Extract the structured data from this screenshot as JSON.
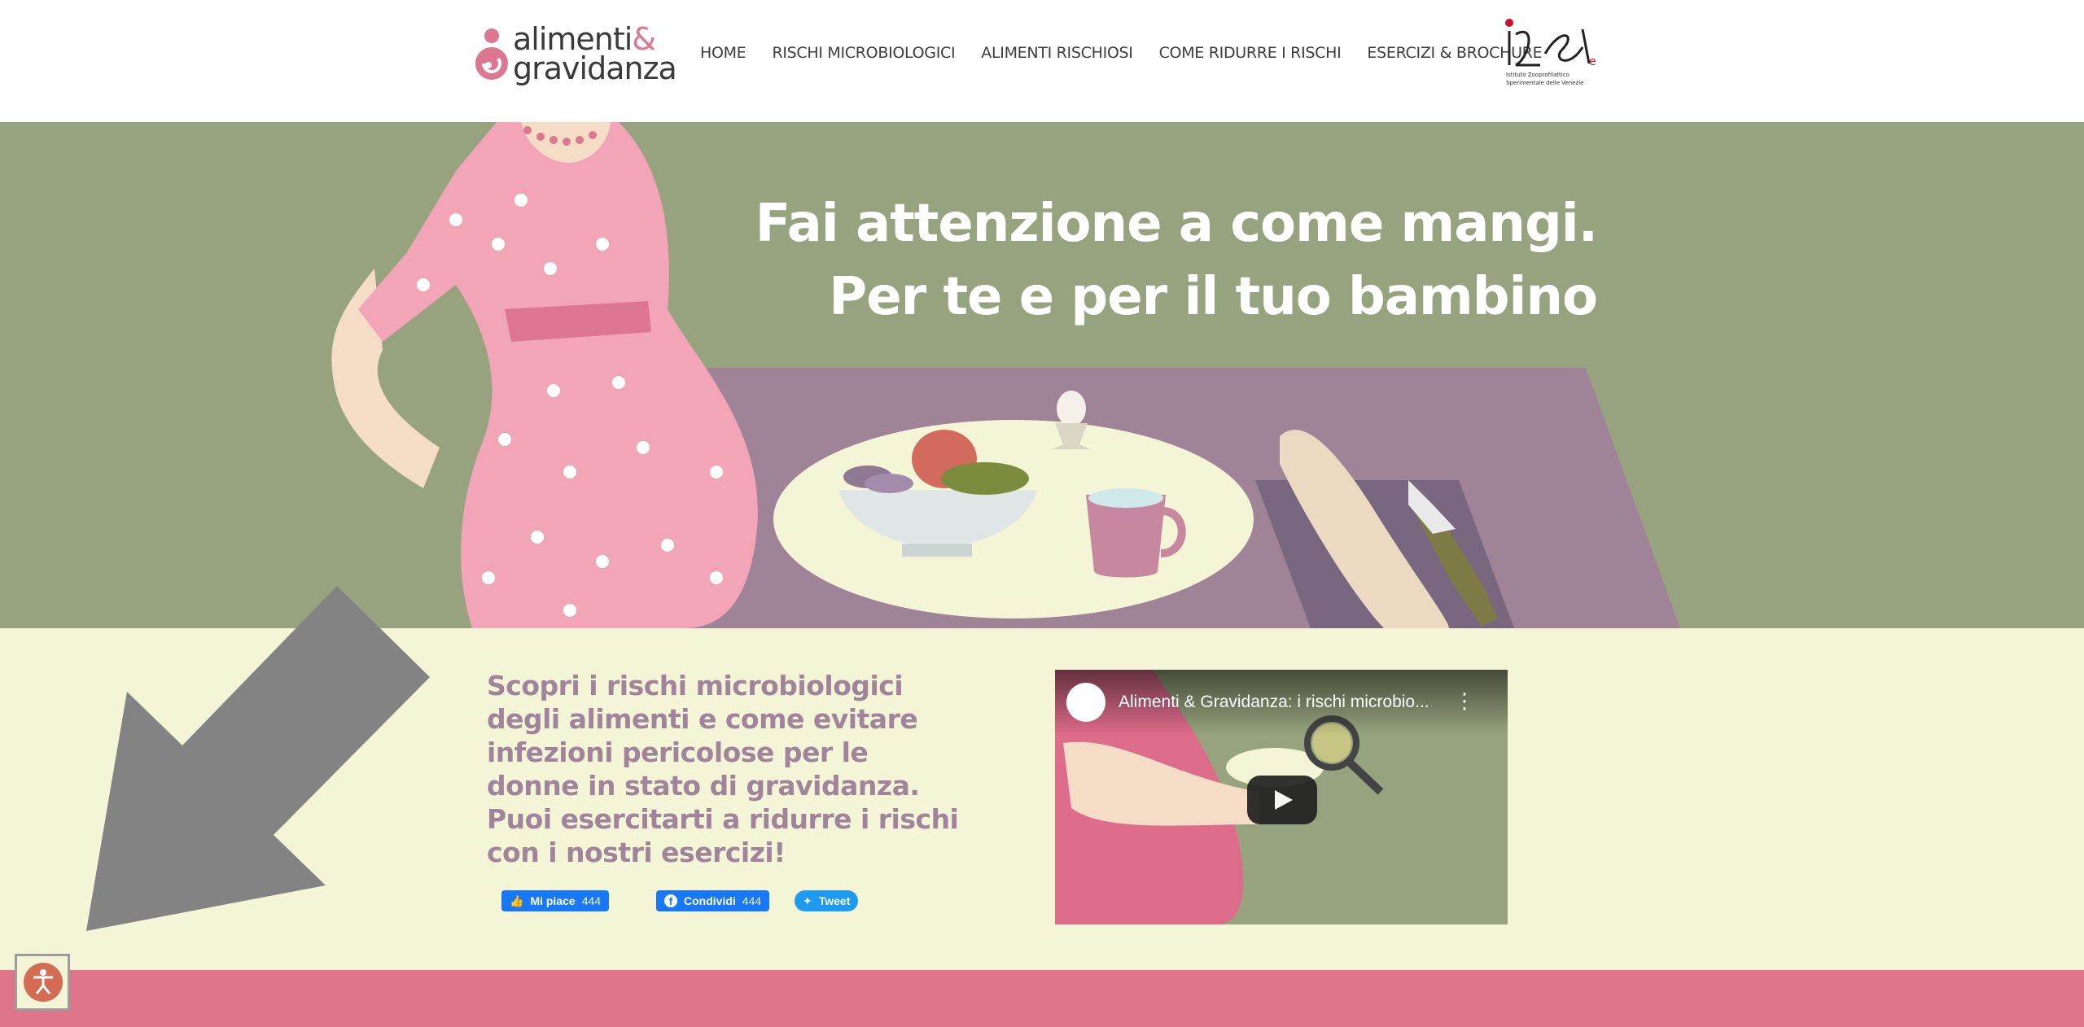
{
  "header": {
    "logo": {
      "line1": "alimenti",
      "amp": "&",
      "line2": "gravidanza"
    },
    "nav": [
      {
        "label": "HOME"
      },
      {
        "label": "RISCHI MICROBIOLOGICI"
      },
      {
        "label": "ALIMENTI RISCHIOSI"
      },
      {
        "label": "COME RIDURRE I RISCHI"
      },
      {
        "label": "ESERCIZI & BROCHURE"
      }
    ],
    "partner_logo_text": "Istituto Zooprofilattico Sperimentale delle Venezie"
  },
  "hero": {
    "title_line1": "Fai attenzione a come mangi.",
    "title_line2": "Per te e per il tuo bambino"
  },
  "intro": {
    "text": "Scopri i rischi microbiologici degli alimenti e come evitare infezioni pericolose per le donne in stato di gravidanza. Puoi esercitarti a ridurre i rischi con i nostri esercizi!"
  },
  "social": {
    "like_label": "Mi piace",
    "like_count": "444",
    "share_label": "Condividi",
    "share_count": "444",
    "tweet_label": "Tweet"
  },
  "video": {
    "title": "Alimenti & Gravidanza: i rischi microbio..."
  },
  "colors": {
    "hero_bg": "#97a37e",
    "band_bg": "#f4f4d6",
    "accent_pink": "#de7489",
    "text_mauve": "#a0849b"
  }
}
